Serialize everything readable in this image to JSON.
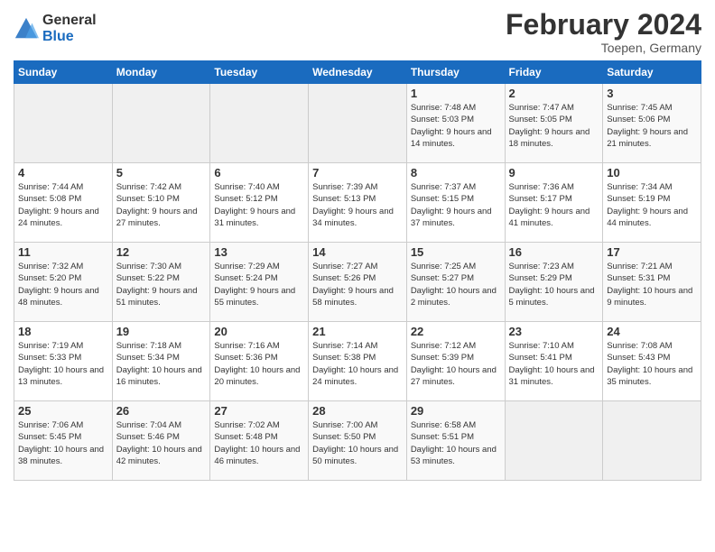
{
  "header": {
    "logo_general": "General",
    "logo_blue": "Blue",
    "month_title": "February 2024",
    "location": "Toepen, Germany"
  },
  "days_of_week": [
    "Sunday",
    "Monday",
    "Tuesday",
    "Wednesday",
    "Thursday",
    "Friday",
    "Saturday"
  ],
  "weeks": [
    {
      "days": [
        {
          "number": "",
          "empty": true
        },
        {
          "number": "",
          "empty": true
        },
        {
          "number": "",
          "empty": true
        },
        {
          "number": "",
          "empty": true
        },
        {
          "number": "1",
          "sunrise": "7:48 AM",
          "sunset": "5:03 PM",
          "daylight": "9 hours and 14 minutes."
        },
        {
          "number": "2",
          "sunrise": "7:47 AM",
          "sunset": "5:05 PM",
          "daylight": "9 hours and 18 minutes."
        },
        {
          "number": "3",
          "sunrise": "7:45 AM",
          "sunset": "5:06 PM",
          "daylight": "9 hours and 21 minutes."
        }
      ]
    },
    {
      "days": [
        {
          "number": "4",
          "sunrise": "7:44 AM",
          "sunset": "5:08 PM",
          "daylight": "9 hours and 24 minutes."
        },
        {
          "number": "5",
          "sunrise": "7:42 AM",
          "sunset": "5:10 PM",
          "daylight": "9 hours and 27 minutes."
        },
        {
          "number": "6",
          "sunrise": "7:40 AM",
          "sunset": "5:12 PM",
          "daylight": "9 hours and 31 minutes."
        },
        {
          "number": "7",
          "sunrise": "7:39 AM",
          "sunset": "5:13 PM",
          "daylight": "9 hours and 34 minutes."
        },
        {
          "number": "8",
          "sunrise": "7:37 AM",
          "sunset": "5:15 PM",
          "daylight": "9 hours and 37 minutes."
        },
        {
          "number": "9",
          "sunrise": "7:36 AM",
          "sunset": "5:17 PM",
          "daylight": "9 hours and 41 minutes."
        },
        {
          "number": "10",
          "sunrise": "7:34 AM",
          "sunset": "5:19 PM",
          "daylight": "9 hours and 44 minutes."
        }
      ]
    },
    {
      "days": [
        {
          "number": "11",
          "sunrise": "7:32 AM",
          "sunset": "5:20 PM",
          "daylight": "9 hours and 48 minutes."
        },
        {
          "number": "12",
          "sunrise": "7:30 AM",
          "sunset": "5:22 PM",
          "daylight": "9 hours and 51 minutes."
        },
        {
          "number": "13",
          "sunrise": "7:29 AM",
          "sunset": "5:24 PM",
          "daylight": "9 hours and 55 minutes."
        },
        {
          "number": "14",
          "sunrise": "7:27 AM",
          "sunset": "5:26 PM",
          "daylight": "9 hours and 58 minutes."
        },
        {
          "number": "15",
          "sunrise": "7:25 AM",
          "sunset": "5:27 PM",
          "daylight": "10 hours and 2 minutes."
        },
        {
          "number": "16",
          "sunrise": "7:23 AM",
          "sunset": "5:29 PM",
          "daylight": "10 hours and 5 minutes."
        },
        {
          "number": "17",
          "sunrise": "7:21 AM",
          "sunset": "5:31 PM",
          "daylight": "10 hours and 9 minutes."
        }
      ]
    },
    {
      "days": [
        {
          "number": "18",
          "sunrise": "7:19 AM",
          "sunset": "5:33 PM",
          "daylight": "10 hours and 13 minutes."
        },
        {
          "number": "19",
          "sunrise": "7:18 AM",
          "sunset": "5:34 PM",
          "daylight": "10 hours and 16 minutes."
        },
        {
          "number": "20",
          "sunrise": "7:16 AM",
          "sunset": "5:36 PM",
          "daylight": "10 hours and 20 minutes."
        },
        {
          "number": "21",
          "sunrise": "7:14 AM",
          "sunset": "5:38 PM",
          "daylight": "10 hours and 24 minutes."
        },
        {
          "number": "22",
          "sunrise": "7:12 AM",
          "sunset": "5:39 PM",
          "daylight": "10 hours and 27 minutes."
        },
        {
          "number": "23",
          "sunrise": "7:10 AM",
          "sunset": "5:41 PM",
          "daylight": "10 hours and 31 minutes."
        },
        {
          "number": "24",
          "sunrise": "7:08 AM",
          "sunset": "5:43 PM",
          "daylight": "10 hours and 35 minutes."
        }
      ]
    },
    {
      "days": [
        {
          "number": "25",
          "sunrise": "7:06 AM",
          "sunset": "5:45 PM",
          "daylight": "10 hours and 38 minutes."
        },
        {
          "number": "26",
          "sunrise": "7:04 AM",
          "sunset": "5:46 PM",
          "daylight": "10 hours and 42 minutes."
        },
        {
          "number": "27",
          "sunrise": "7:02 AM",
          "sunset": "5:48 PM",
          "daylight": "10 hours and 46 minutes."
        },
        {
          "number": "28",
          "sunrise": "7:00 AM",
          "sunset": "5:50 PM",
          "daylight": "10 hours and 50 minutes."
        },
        {
          "number": "29",
          "sunrise": "6:58 AM",
          "sunset": "5:51 PM",
          "daylight": "10 hours and 53 minutes."
        },
        {
          "number": "",
          "empty": true
        },
        {
          "number": "",
          "empty": true
        }
      ]
    }
  ]
}
